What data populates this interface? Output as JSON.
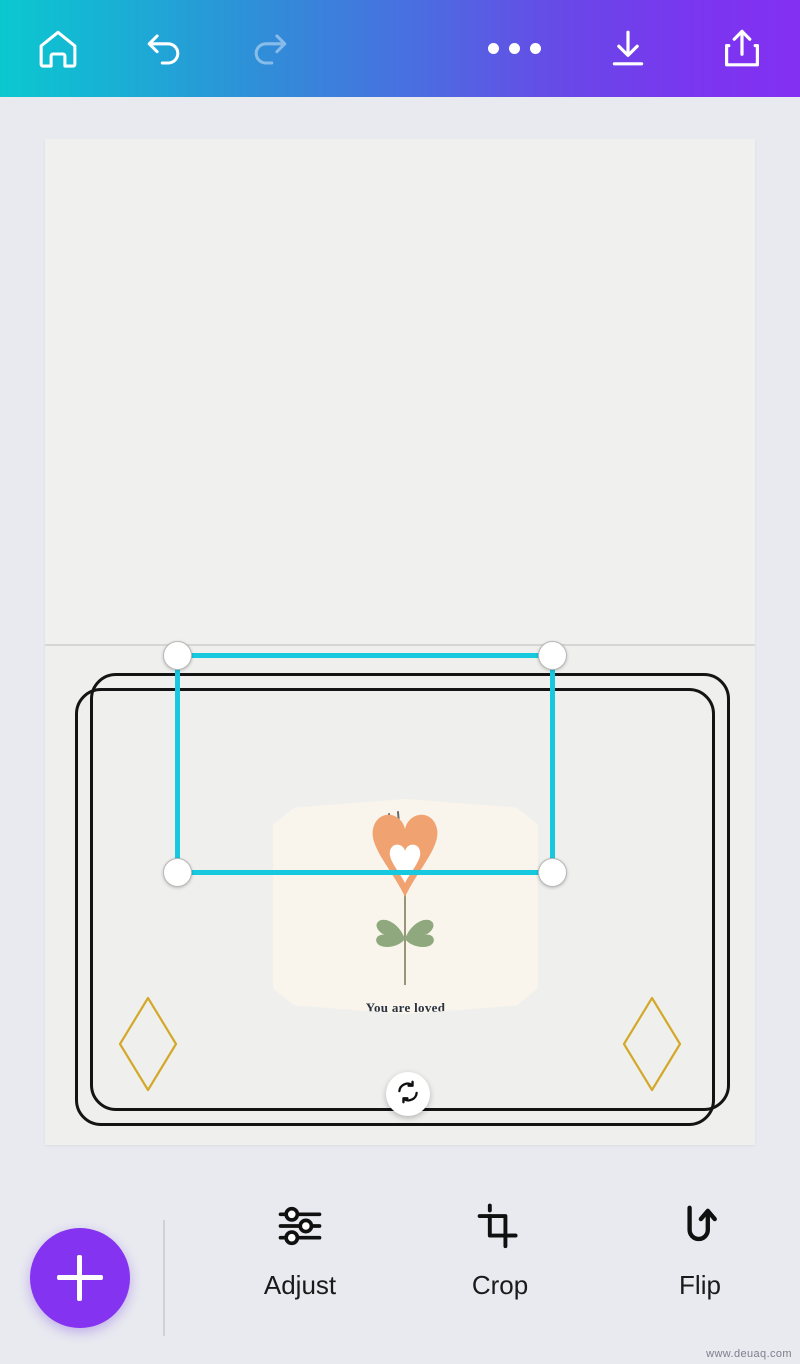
{
  "app": {
    "background_color": "#e9eaf0",
    "watermark": "www.deuaq.com"
  },
  "topbar": {
    "gradient_from": "#0bc8cf",
    "gradient_to": "#8330f2",
    "left_actions": [
      {
        "name": "home-icon",
        "label": "Home",
        "enabled": true
      },
      {
        "name": "undo-icon",
        "label": "Undo",
        "enabled": true
      },
      {
        "name": "redo-icon",
        "label": "Redo",
        "enabled": false
      }
    ],
    "right_actions": [
      {
        "name": "more-options-icon",
        "label": "More options"
      },
      {
        "name": "download-icon",
        "label": "Download"
      },
      {
        "name": "share-icon",
        "label": "Share"
      }
    ]
  },
  "canvas": {
    "page_top": {
      "label": "Card inside page",
      "content": ""
    },
    "page_bottom": {
      "label": "Card cover page"
    },
    "frame": {
      "style": "double-rounded-rectangle",
      "color": "#141414"
    },
    "decorations": [
      {
        "name": "diamond-left",
        "shape": "diamond-outline",
        "color": "#d4a829"
      },
      {
        "name": "diamond-right",
        "shape": "diamond-outline",
        "color": "#d4a829"
      }
    ],
    "image_object": {
      "name": "heart-flower-illustration",
      "background_color": "#faf5ec",
      "heart_color": "#f0a371",
      "inner_heart_color": "#ffffff",
      "leaf_color": "#8fa87e",
      "stem_color": "#9b9578",
      "caption": "You are loved"
    },
    "selection": {
      "color": "#17c9df",
      "handle_color": "#ffffff",
      "handles": [
        "top-left",
        "top-right",
        "bottom-left",
        "bottom-right"
      ],
      "rotate_button": {
        "name": "rotate-icon",
        "label": "Rotate"
      }
    }
  },
  "bottombar": {
    "add_button": {
      "name": "add-button",
      "label": "+",
      "color": "#8433f0"
    },
    "tools": [
      {
        "name": "adjust",
        "label": "Adjust",
        "icon": "sliders-icon"
      },
      {
        "name": "crop",
        "label": "Crop",
        "icon": "crop-icon"
      },
      {
        "name": "flip",
        "label": "Flip",
        "icon": "flip-icon"
      }
    ]
  }
}
